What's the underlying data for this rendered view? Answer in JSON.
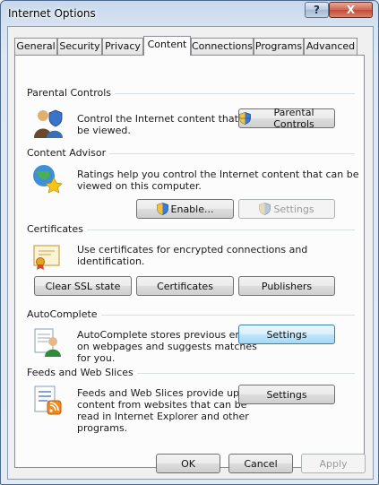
{
  "window": {
    "title": "Internet Options",
    "help_label": "?",
    "close_label": "X"
  },
  "tabs": [
    {
      "label": "General"
    },
    {
      "label": "Security"
    },
    {
      "label": "Privacy"
    },
    {
      "label": "Content",
      "active": true
    },
    {
      "label": "Connections"
    },
    {
      "label": "Programs"
    },
    {
      "label": "Advanced"
    }
  ],
  "parental_controls": {
    "heading": "Parental Controls",
    "line1": "Control the Internet content that can",
    "line2": "be viewed.",
    "button": "Parental Controls"
  },
  "content_advisor": {
    "heading": "Content Advisor",
    "line1": "Ratings help you control the Internet content that can be",
    "line2": "viewed on this computer.",
    "enable_button": "Enable...",
    "settings_button": "Settings"
  },
  "certificates": {
    "heading": "Certificates",
    "line1": "Use certificates for encrypted connections and identification.",
    "clear_ssl_button": "Clear SSL state",
    "certificates_button": "Certificates",
    "publishers_button": "Publishers"
  },
  "autocomplete": {
    "heading": "AutoComplete",
    "line1": "AutoComplete stores previous entries",
    "line2": "on webpages and suggests matches",
    "line3": "for you.",
    "settings_button": "Settings"
  },
  "feeds": {
    "heading": "Feeds and Web Slices",
    "line1": "Feeds and Web Slices provide updated",
    "line2": "content from websites that can be",
    "line3": "read in Internet Explorer and other",
    "line4": "programs.",
    "settings_button": "Settings"
  },
  "footer": {
    "ok": "OK",
    "cancel": "Cancel",
    "apply": "Apply"
  },
  "icons": {
    "parental": "parental-controls-icon",
    "advisor": "content-advisor-icon",
    "certificates": "certificate-icon",
    "autocomplete": "autocomplete-icon",
    "feeds": "feeds-icon",
    "uac": "uac-shield-icon"
  },
  "colors": {
    "focus_button": "#bee6fd",
    "close_button": "#c24a33",
    "panel": "#fcfcfc"
  }
}
